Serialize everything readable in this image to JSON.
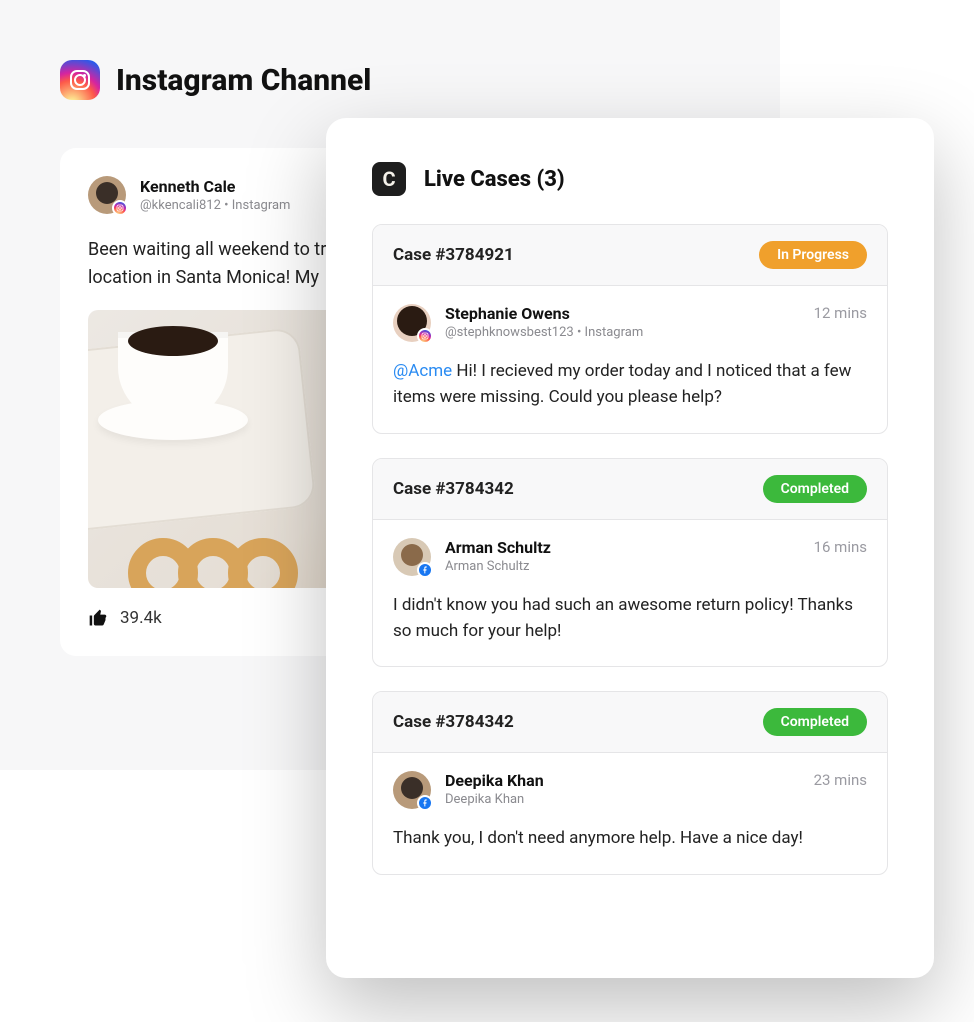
{
  "channel": {
    "title": "Instagram Channel"
  },
  "post": {
    "author_name": "Kenneth Cale",
    "author_handle": "@kkencali812",
    "author_source": "Instagram",
    "body": "Been waiting all weekend to try @Acme's new brunch location in Santa Monica! My",
    "like_count": "39.4k"
  },
  "cases_panel": {
    "title": "Live Cases (3)",
    "cases": [
      {
        "id_label": "Case #3784921",
        "status_label": "In Progress",
        "status_kind": "progress",
        "user_name": "Stephanie Owens",
        "user_meta": "@stephknowsbest123 • Instagram",
        "user_network": "instagram",
        "time": "12 mins",
        "mention": "@Acme",
        "message": " Hi! I recieved my order today and I noticed that a few items were missing. Could you please help?"
      },
      {
        "id_label": "Case #3784342",
        "status_label": "Completed",
        "status_kind": "completed",
        "user_name": "Arman Schultz",
        "user_meta": "Arman Schultz",
        "user_network": "facebook",
        "time": "16 mins",
        "mention": "",
        "message": "I didn't know you had such an awesome return policy! Thanks so much for your help!"
      },
      {
        "id_label": "Case #3784342",
        "status_label": "Completed",
        "status_kind": "completed",
        "user_name": "Deepika Khan",
        "user_meta": "Deepika Khan",
        "user_network": "facebook",
        "time": "23 mins",
        "mention": "",
        "message": "Thank you, I don't need anymore help. Have a nice day!"
      }
    ]
  }
}
